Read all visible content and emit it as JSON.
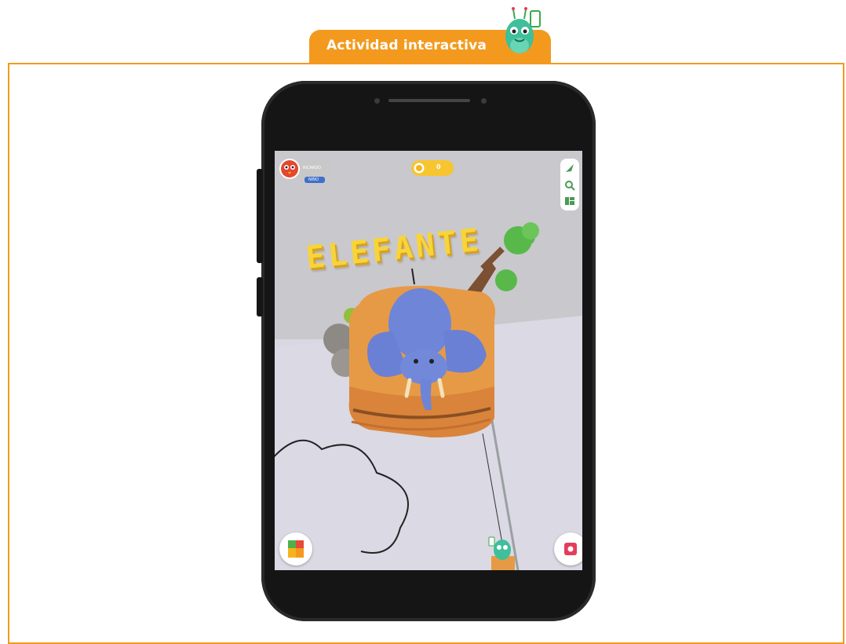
{
  "header": {
    "tab_label": "Actividad interactiva"
  },
  "app": {
    "user": {
      "name": "RICARDO",
      "level": "NIÑO"
    },
    "coins": "0",
    "ar_word": "ELEFANTE"
  },
  "colors": {
    "accent": "#f39a1e",
    "phone_body": "#151515",
    "coin": "#f7c530",
    "elephant": "#6f85d8",
    "block": "#e79a45",
    "letters": "#f7d43a",
    "record": "#e53d5a"
  },
  "icons": {
    "avatar": "red-bird-avatar-icon",
    "coin": "coin-icon",
    "compass": "compass-icon",
    "zoom": "magnifier-icon",
    "layout": "layout-grid-icon",
    "blocks": "colored-blocks-icon",
    "record": "record-icon"
  }
}
